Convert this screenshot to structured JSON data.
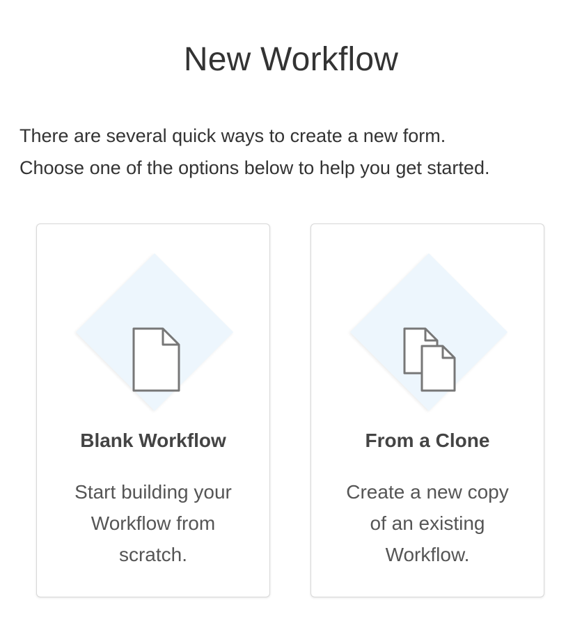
{
  "page": {
    "title": "New Workflow",
    "intro_lines": [
      "There are several quick ways to create a new form.",
      "Choose one of the options below to help you get started."
    ]
  },
  "options": [
    {
      "title": "Blank Workflow",
      "description_lines": [
        "Start building your",
        "Workflow from",
        "scratch."
      ],
      "icon": "document-icon"
    },
    {
      "title": "From a Clone",
      "description_lines": [
        "Create a new copy",
        "of an existing",
        "Workflow."
      ],
      "icon": "copy-documents-icon"
    }
  ],
  "colors": {
    "diamond_fill": "#edf6fd",
    "icon_stroke": "#777777",
    "card_border": "#d8d8d8",
    "text": "#333333"
  }
}
